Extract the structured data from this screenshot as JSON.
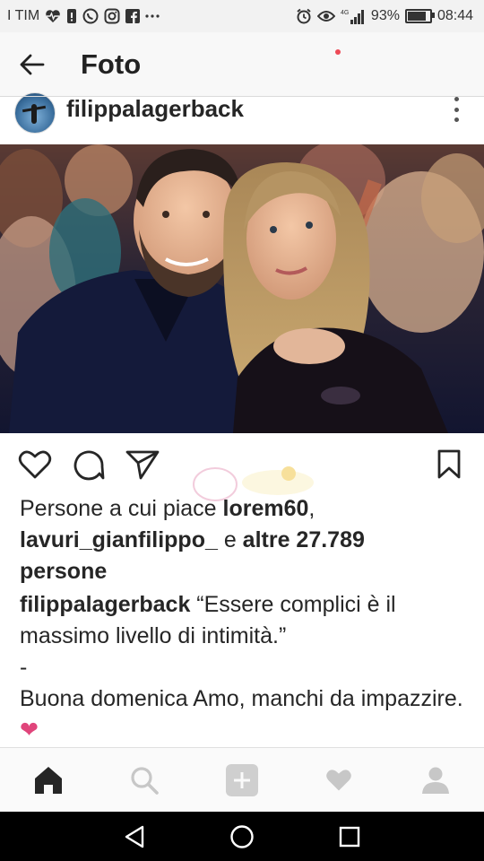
{
  "status_bar": {
    "carrier": "I TIM",
    "battery_percent": "93%",
    "battery_level": 0.93,
    "time": "08:44",
    "network": "4G",
    "left_icons": [
      "heart-pulse-icon",
      "notification-icon",
      "whatsapp-icon",
      "instagram-icon",
      "facebook-icon",
      "more-dots-icon"
    ],
    "right_icons": [
      "alarm-icon",
      "eye-icon",
      "signal-icon",
      "battery-icon"
    ]
  },
  "header": {
    "title": "Foto",
    "back_icon": "arrow-left-icon"
  },
  "post": {
    "username": "filippalagerback",
    "actions": [
      "heart-icon",
      "comment-icon",
      "send-icon",
      "bookmark-icon"
    ],
    "likes": {
      "prefix": "Persone a cui piace ",
      "user1": "lorem60",
      "comma": ",",
      "user2": "lavuri_gianfilippo_",
      "conj": " e ",
      "others": "altre 27.789",
      "persone": "persone"
    },
    "caption": {
      "author": "filippalagerback",
      "text": " “Essere complici è il massimo livello di intimità.”",
      "dash": "-",
      "line2": "Buona domenica Amo, manchi da impazzire. ",
      "emoji": "❤"
    }
  },
  "tabbar": {
    "tabs": [
      "home-icon",
      "search-icon",
      "add-icon",
      "activity-heart-icon",
      "profile-icon"
    ],
    "active": "home-icon"
  },
  "colors": {
    "accent_heart": "#e0457b",
    "notif_dot": "#ed4956"
  }
}
